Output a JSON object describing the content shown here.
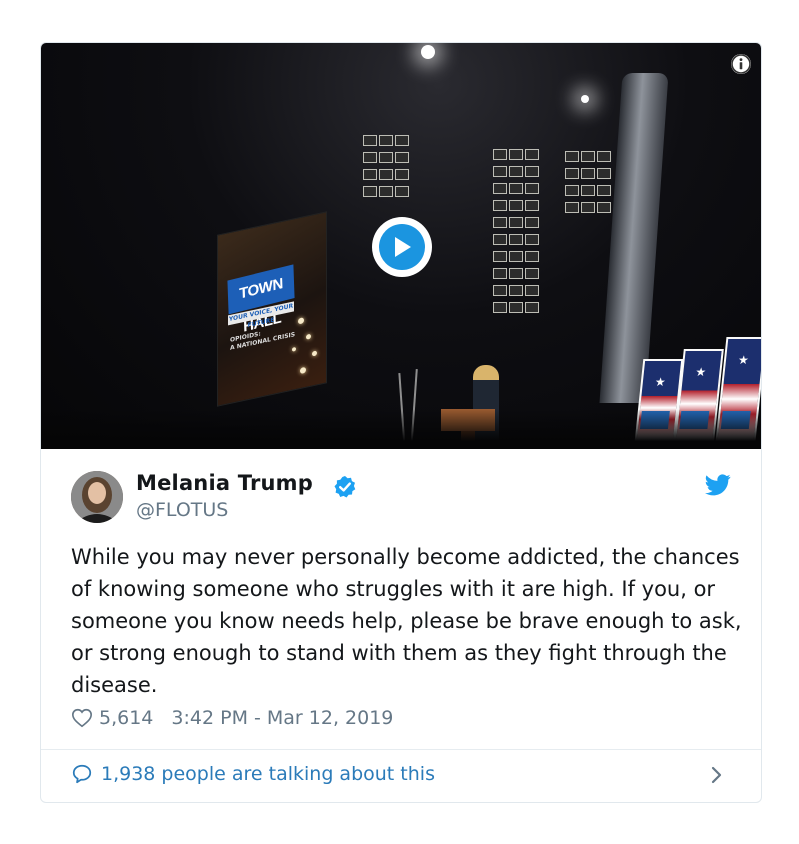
{
  "media": {
    "play_icon": "play-icon",
    "info_icon": "info-icon",
    "screen_title": "TOWN HALL",
    "screen_subtitle": "YOUR VOICE, YOUR FUTURE",
    "screen_caption_1": "OPIOIDS:",
    "screen_caption_2": "A NATIONAL CRISIS"
  },
  "tweet": {
    "author_name": "Melania Trump",
    "author_handle": "@FLOTUS",
    "verified_icon": "verified-badge-icon",
    "brand_icon": "twitter-bird-icon",
    "text": "While you may never personally become addicted, the chances of knowing someone who struggles with it are high. If you, or someone you know needs help, please be brave enough to ask, or strong enough to stand with them as they fight through the disease.",
    "likes": "5,614",
    "timestamp": "3:42 PM - Mar 12, 2019",
    "talking": "1,938 people are talking about this"
  },
  "colors": {
    "text": "#14171a",
    "muted": "#657786",
    "link": "#2b7bb9",
    "twitter_blue": "#1da1f2",
    "border": "#e1e8ed"
  }
}
